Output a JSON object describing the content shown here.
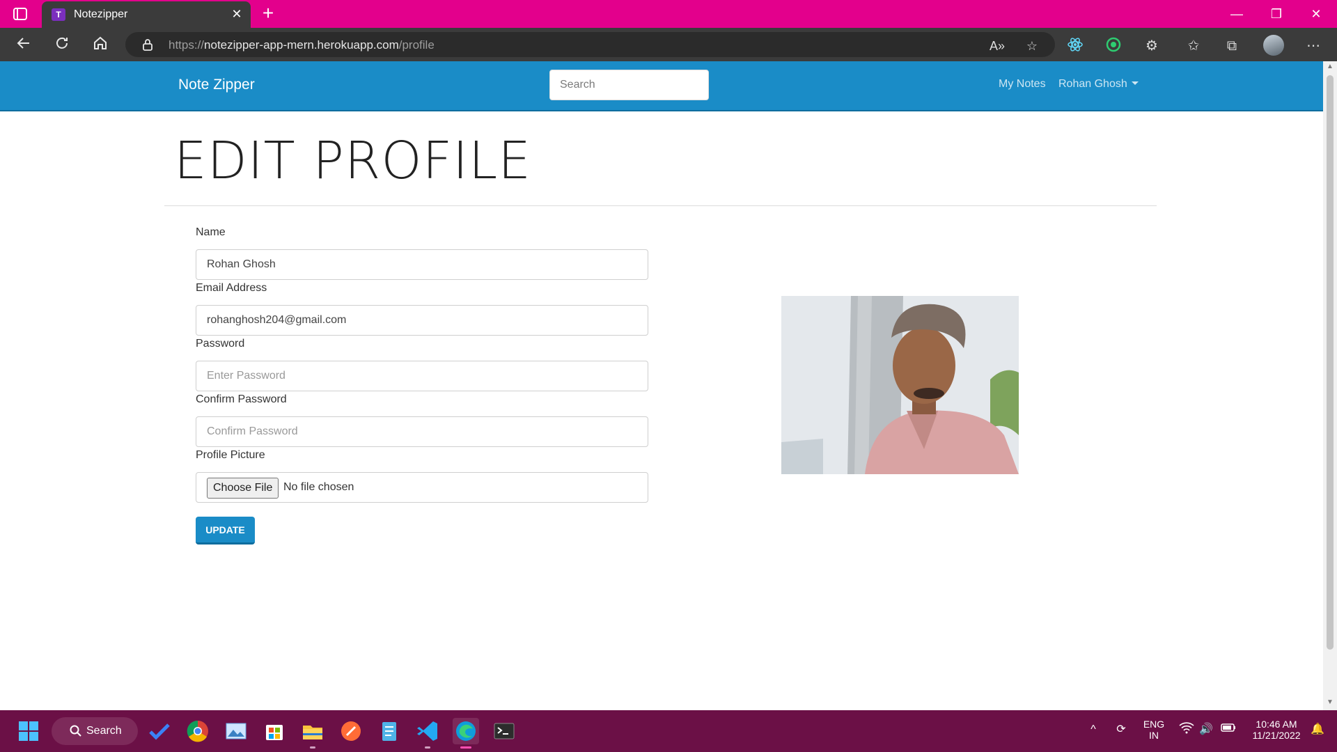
{
  "browser": {
    "tab_title": "Notezipper",
    "tab_favicon_text": "T",
    "url_scheme": "https://",
    "url_host": "notezipper-app-mern.herokuapp.com",
    "url_path": "/profile",
    "accent_color": "#e3008c"
  },
  "site": {
    "brand": "Note Zipper",
    "search_placeholder": "Search",
    "nav_links": {
      "my_notes": "My Notes",
      "user_menu": "Rohan Ghosh"
    },
    "primary_color": "#1a8cc7"
  },
  "profile_form": {
    "page_title": "EDIT PROFILE",
    "name_label": "Name",
    "name_value": "Rohan Ghosh",
    "email_label": "Email Address",
    "email_value": "rohanghosh204@gmail.com",
    "password_label": "Password",
    "password_placeholder": "Enter Password",
    "confirm_label": "Confirm Password",
    "confirm_placeholder": "Confirm Password",
    "picture_label": "Profile Picture",
    "choose_file_label": "Choose File",
    "file_status": "No file chosen",
    "update_label": "UPDATE"
  },
  "taskbar": {
    "search_label": "Search",
    "language_line1": "ENG",
    "language_line2": "IN",
    "time": "10:46 AM",
    "date": "11/21/2022"
  }
}
